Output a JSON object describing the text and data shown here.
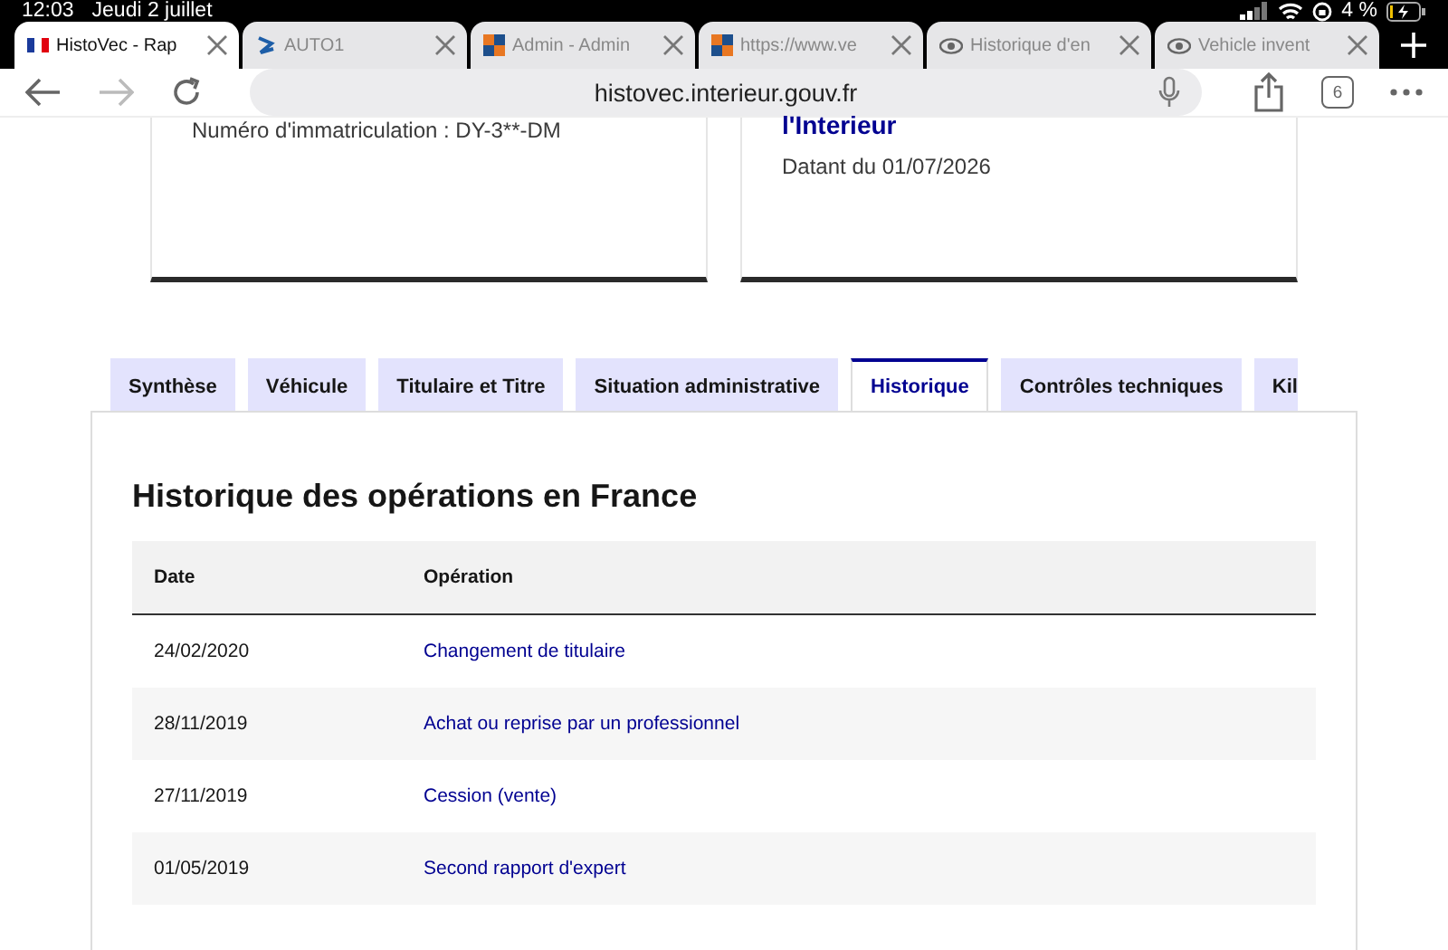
{
  "status_bar": {
    "time": "12:03",
    "date": "Jeudi 2 juillet",
    "battery": "4 %"
  },
  "browser_tabs": [
    {
      "title": "HistoVec - Rap",
      "selected": true,
      "kind": "flag"
    },
    {
      "title": "AUTO1",
      "selected": false,
      "kind": "auto"
    },
    {
      "title": "Admin - Admin",
      "selected": false,
      "kind": "squares"
    },
    {
      "title": "https://www.ve",
      "selected": false,
      "kind": "squares"
    },
    {
      "title": "Historique d'en",
      "selected": false,
      "kind": "eye"
    },
    {
      "title": "Vehicle invent",
      "selected": false,
      "kind": "eye"
    }
  ],
  "address_bar": {
    "url": "histovec.interieur.gouv.fr",
    "tab_count": "6"
  },
  "cards": [
    {
      "lines": [
        {
          "kind": "text",
          "text": "Numéro d'immatriculation : DY-3**-DM"
        }
      ]
    },
    {
      "lines": [
        {
          "kind": "title",
          "text": "l'Interieur"
        },
        {
          "kind": "text",
          "text": "Datant du 01/07/2026"
        }
      ]
    }
  ],
  "page_tabs": [
    {
      "label": "Synthèse",
      "selected": false
    },
    {
      "label": "Véhicule",
      "selected": false
    },
    {
      "label": "Titulaire et Titre",
      "selected": false
    },
    {
      "label": "Situation administrative",
      "selected": false
    },
    {
      "label": "Historique",
      "selected": true
    },
    {
      "label": "Contrôles techniques",
      "selected": false
    },
    {
      "label": "Kil",
      "selected": false
    }
  ],
  "section": {
    "title": "Historique des opérations en France",
    "table": {
      "columns": [
        "Date",
        "Opération"
      ],
      "rows": [
        [
          "24/02/2020",
          "Changement de titulaire"
        ],
        [
          "28/11/2019",
          "Achat ou reprise par un professionnel"
        ],
        [
          "27/11/2019",
          "Cession (vente)"
        ],
        [
          "01/05/2019",
          "Second rapport d'expert"
        ]
      ]
    }
  }
}
